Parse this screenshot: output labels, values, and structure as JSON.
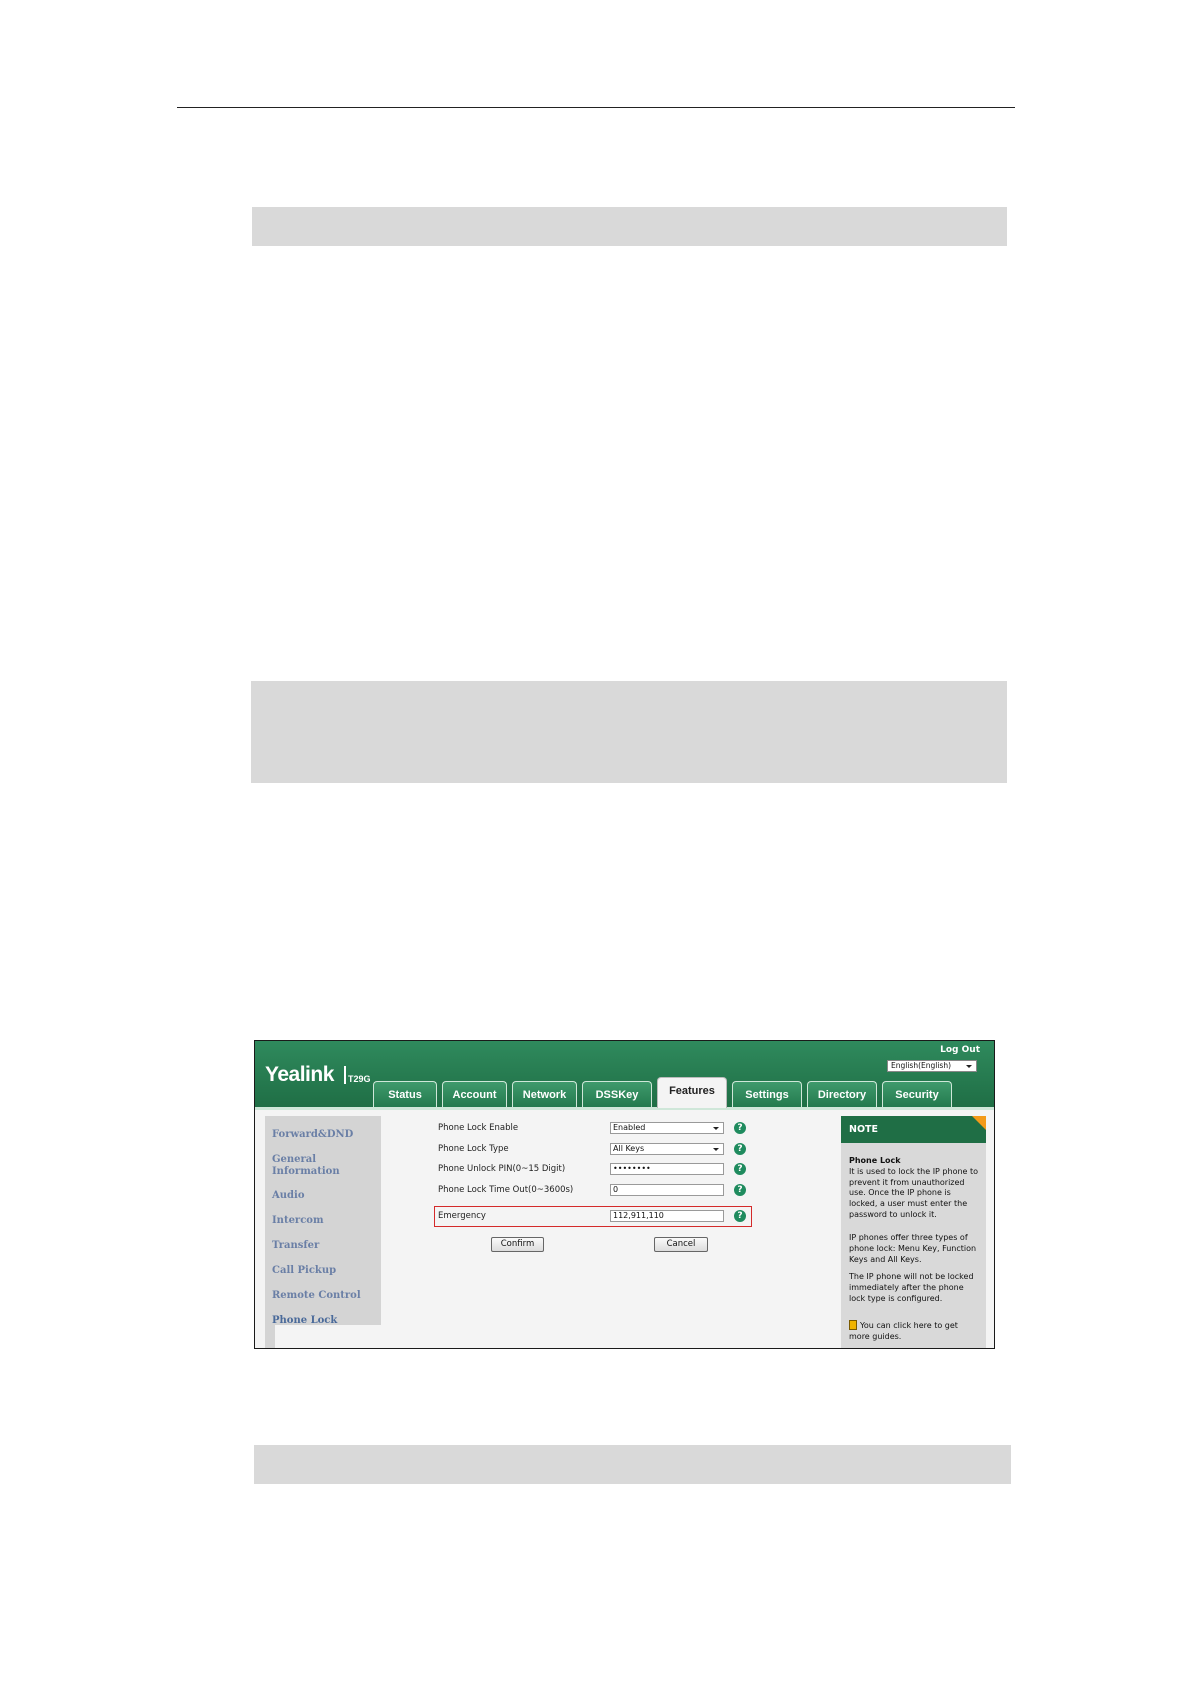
{
  "app": {
    "logo": "Yealink",
    "model": "T29G",
    "logout": "Log Out",
    "language": "English(English)",
    "tabs": [
      "Status",
      "Account",
      "Network",
      "DSSKey",
      "Features",
      "Settings",
      "Directory",
      "Security"
    ],
    "active_tab": "Features"
  },
  "sidebar": {
    "items": [
      "Forward&DND",
      "General\nInformation",
      "Audio",
      "Intercom",
      "Transfer",
      "Call Pickup",
      "Remote Control",
      "Phone Lock"
    ],
    "active": "Phone Lock"
  },
  "form": {
    "rows": [
      {
        "label": "Phone Lock Enable",
        "value": "Enabled"
      },
      {
        "label": "Phone Lock Type",
        "value": "All Keys"
      },
      {
        "label": "Phone Unlock PIN(0~15 Digit)",
        "value": "••••••••"
      },
      {
        "label": "Phone Lock Time Out(0~3600s)",
        "value": "0"
      },
      {
        "label": "Emergency",
        "value": "112,911,110"
      }
    ],
    "confirm": "Confirm",
    "cancel": "Cancel",
    "help": "?"
  },
  "note": {
    "title": "NOTE",
    "heading": "Phone Lock",
    "p1": "It is used to lock the IP phone to prevent it from unauthorized use. Once the IP phone is locked, a user must enter the password to unlock it.",
    "p2": "IP phones offer three types of phone lock: Menu Key, Function Keys and All Keys.",
    "p3": "The IP phone will not be locked immediately after the phone lock type is configured.",
    "p4": "You can click here to get more guides."
  }
}
